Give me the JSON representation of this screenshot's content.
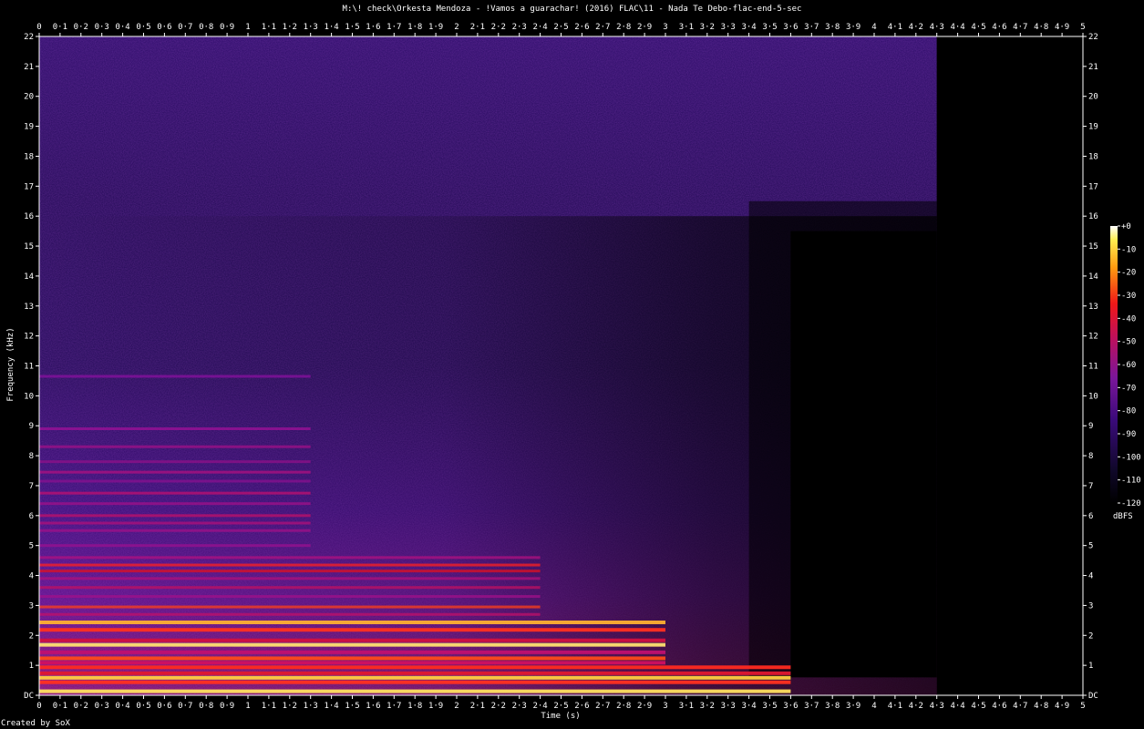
{
  "chart_data": {
    "type": "heatmap",
    "title": "M:\\! check\\Orkesta Mendoza - !Vamos a guarachar! (2016) FLAC\\11 - Nada Te Debo-flac-end-5-sec",
    "xlabel": "Time (s)",
    "ylabel": "Frequency (kHz)",
    "xlim": [
      0,
      5
    ],
    "ylim": [
      0,
      22
    ],
    "x_ticks": [
      "0",
      "0·1",
      "0·2",
      "0·3",
      "0·4",
      "0·5",
      "0·6",
      "0·7",
      "0·8",
      "0·9",
      "1",
      "1·1",
      "1·2",
      "1·3",
      "1·4",
      "1·5",
      "1·6",
      "1·7",
      "1·8",
      "1·9",
      "2",
      "2·1",
      "2·2",
      "2·3",
      "2·4",
      "2·5",
      "2·6",
      "2·7",
      "2·8",
      "2·9",
      "3",
      "3·1",
      "3·2",
      "3·3",
      "3·4",
      "3·5",
      "3·6",
      "3·7",
      "3·8",
      "3·9",
      "4",
      "4·1",
      "4·2",
      "4·3",
      "4·4",
      "4·5",
      "4·6",
      "4·7",
      "4·8",
      "4·9",
      "5"
    ],
    "y_ticks": [
      "DC",
      "1",
      "2",
      "3",
      "4",
      "5",
      "6",
      "7",
      "8",
      "9",
      "10",
      "11",
      "12",
      "13",
      "14",
      "15",
      "16",
      "17",
      "18",
      "19",
      "20",
      "21",
      "22"
    ],
    "colorbar": {
      "label": "dBFS",
      "ticks": [
        "+0",
        "-10",
        "-20",
        "-30",
        "-40",
        "-50",
        "-60",
        "-70",
        "-80",
        "-90",
        "-100",
        "-110",
        "-120"
      ],
      "range": [
        -120,
        0
      ]
    },
    "signal_end_s": 4.3,
    "band_edges": [
      {
        "t": 0.0,
        "f_khz": 22.0
      },
      {
        "t": 4.3,
        "f_khz": 22.0
      }
    ],
    "harmonic_bands_khz": [
      0.15,
      0.45,
      0.6,
      0.75,
      0.95,
      1.1,
      1.25,
      1.45,
      1.7,
      1.85,
      2.2,
      2.45,
      2.7,
      2.95,
      3.3,
      3.6,
      3.9,
      4.15,
      4.35,
      4.6,
      5.0,
      5.5,
      5.75,
      6.0,
      6.4,
      6.75,
      7.15,
      7.45,
      7.8,
      8.3,
      8.9,
      10.65
    ],
    "colors": {
      "background": "#000000",
      "low": "#10082a",
      "mid": "#5a1495",
      "high": "#e8102a",
      "peak": "#ffef7a"
    }
  },
  "footer": {
    "credit": "Created by SoX"
  }
}
